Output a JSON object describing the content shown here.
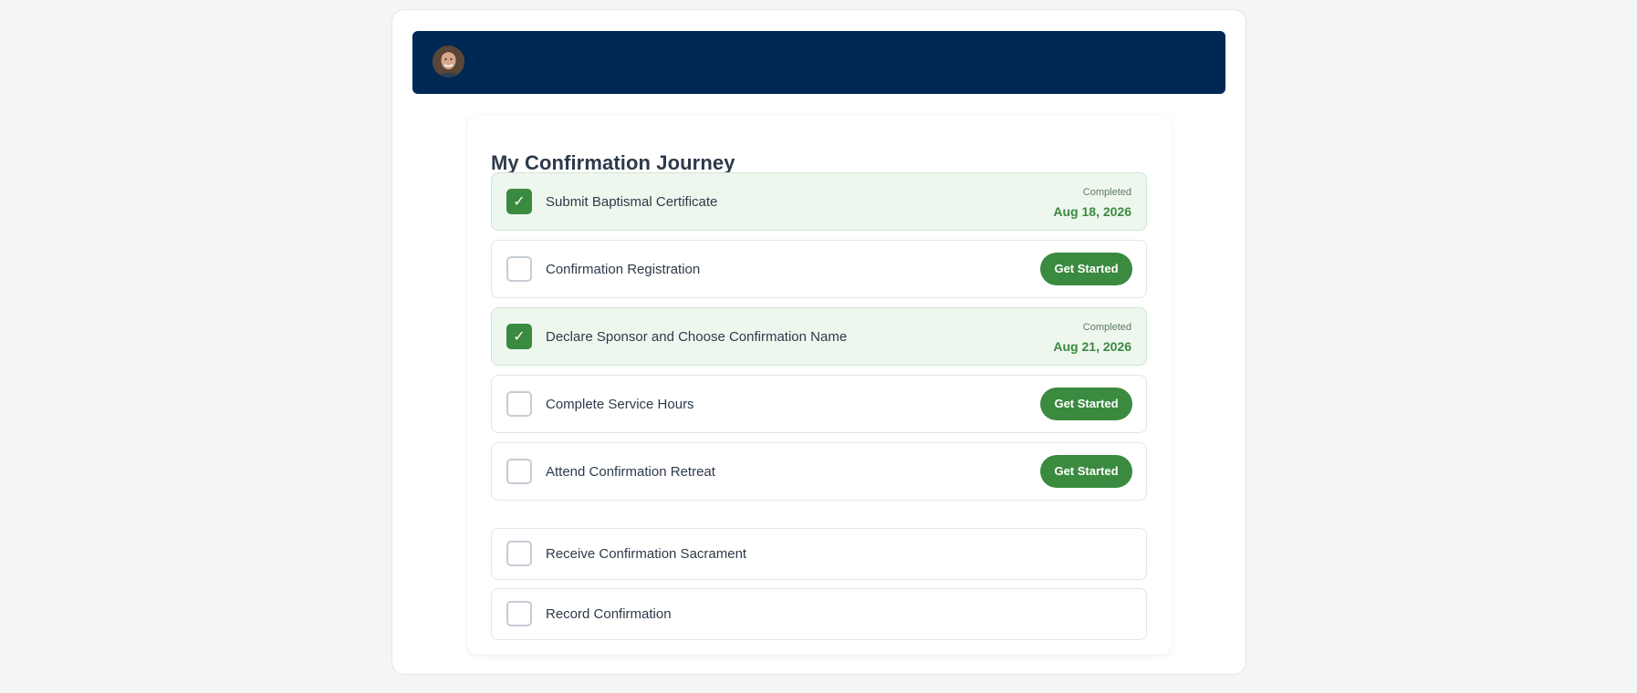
{
  "header": {
    "avatar_alt": "User avatar"
  },
  "journey": {
    "title": "My Confirmation Journey",
    "steps": [
      {
        "label": "Submit Baptismal Certificate",
        "status": "completed",
        "status_label": "Completed",
        "date": "Aug 18, 2026",
        "check_glyph": "✓"
      },
      {
        "label": "Confirmation Registration",
        "status": "pending",
        "action_label": "Get Started"
      },
      {
        "label": "Declare Sponsor and Choose Confirmation Name",
        "status": "completed",
        "status_label": "Completed",
        "date": "Aug 21, 2026",
        "check_glyph": "✓"
      },
      {
        "label": "Complete Service Hours",
        "status": "pending",
        "action_label": "Get Started"
      },
      {
        "label": "Attend Confirmation Retreat",
        "status": "pending",
        "action_label": "Get Started"
      },
      {
        "label": "Receive Confirmation Sacrament",
        "status": "locked"
      },
      {
        "label": "Record Confirmation",
        "status": "locked"
      }
    ]
  },
  "colors": {
    "header_bg": "#002855",
    "accent_green": "#3a8a3f",
    "completed_bg": "#eef7ee"
  },
  "icons": {
    "check": "check-icon",
    "avatar": "user-avatar-photo"
  }
}
